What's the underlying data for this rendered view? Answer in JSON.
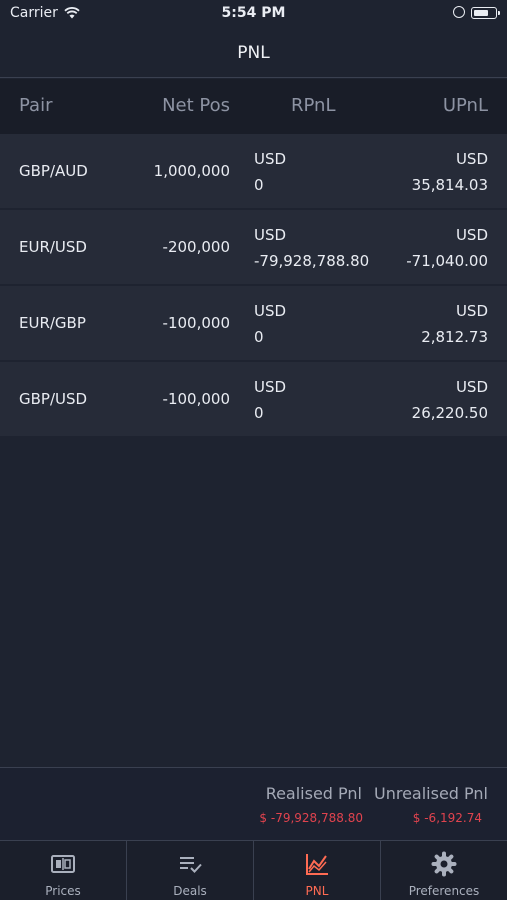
{
  "status_bar": {
    "carrier": "Carrier",
    "time": "5:54 PM"
  },
  "nav": {
    "title": "PNL"
  },
  "table": {
    "headers": [
      "Pair",
      "Net Pos",
      "RPnL",
      "UPnL"
    ],
    "rows": [
      {
        "pair": "GBP/AUD",
        "net_pos": "1,000,000",
        "rpnl_ccy": "USD",
        "rpnl": "0",
        "upnl_ccy": "USD",
        "upnl": "35,814.03"
      },
      {
        "pair": "EUR/USD",
        "net_pos": "-200,000",
        "rpnl_ccy": "USD",
        "rpnl": "-79,928,788.80",
        "upnl_ccy": "USD",
        "upnl": "-71,040.00"
      },
      {
        "pair": "EUR/GBP",
        "net_pos": "-100,000",
        "rpnl_ccy": "USD",
        "rpnl": "0",
        "upnl_ccy": "USD",
        "upnl": "2,812.73"
      },
      {
        "pair": "GBP/USD",
        "net_pos": "-100,000",
        "rpnl_ccy": "USD",
        "rpnl": "0",
        "upnl_ccy": "USD",
        "upnl": "26,220.50"
      }
    ]
  },
  "summary": {
    "realised_label": "Realised Pnl",
    "realised_value": "$ -79,928,788.80",
    "unrealised_label": "Unrealised Pnl",
    "unrealised_value": "$ -6,192.74",
    "negative_color": "#e0434e"
  },
  "tabs": [
    {
      "label": "Prices",
      "icon": "prices-icon"
    },
    {
      "label": "Deals",
      "icon": "deals-icon"
    },
    {
      "label": "PNL",
      "icon": "pnl-chart-icon",
      "active": true
    },
    {
      "label": "Preferences",
      "icon": "gear-icon"
    }
  ],
  "colors": {
    "background": "#1e2330",
    "row": "#262b38",
    "accent": "#ff6b53"
  }
}
